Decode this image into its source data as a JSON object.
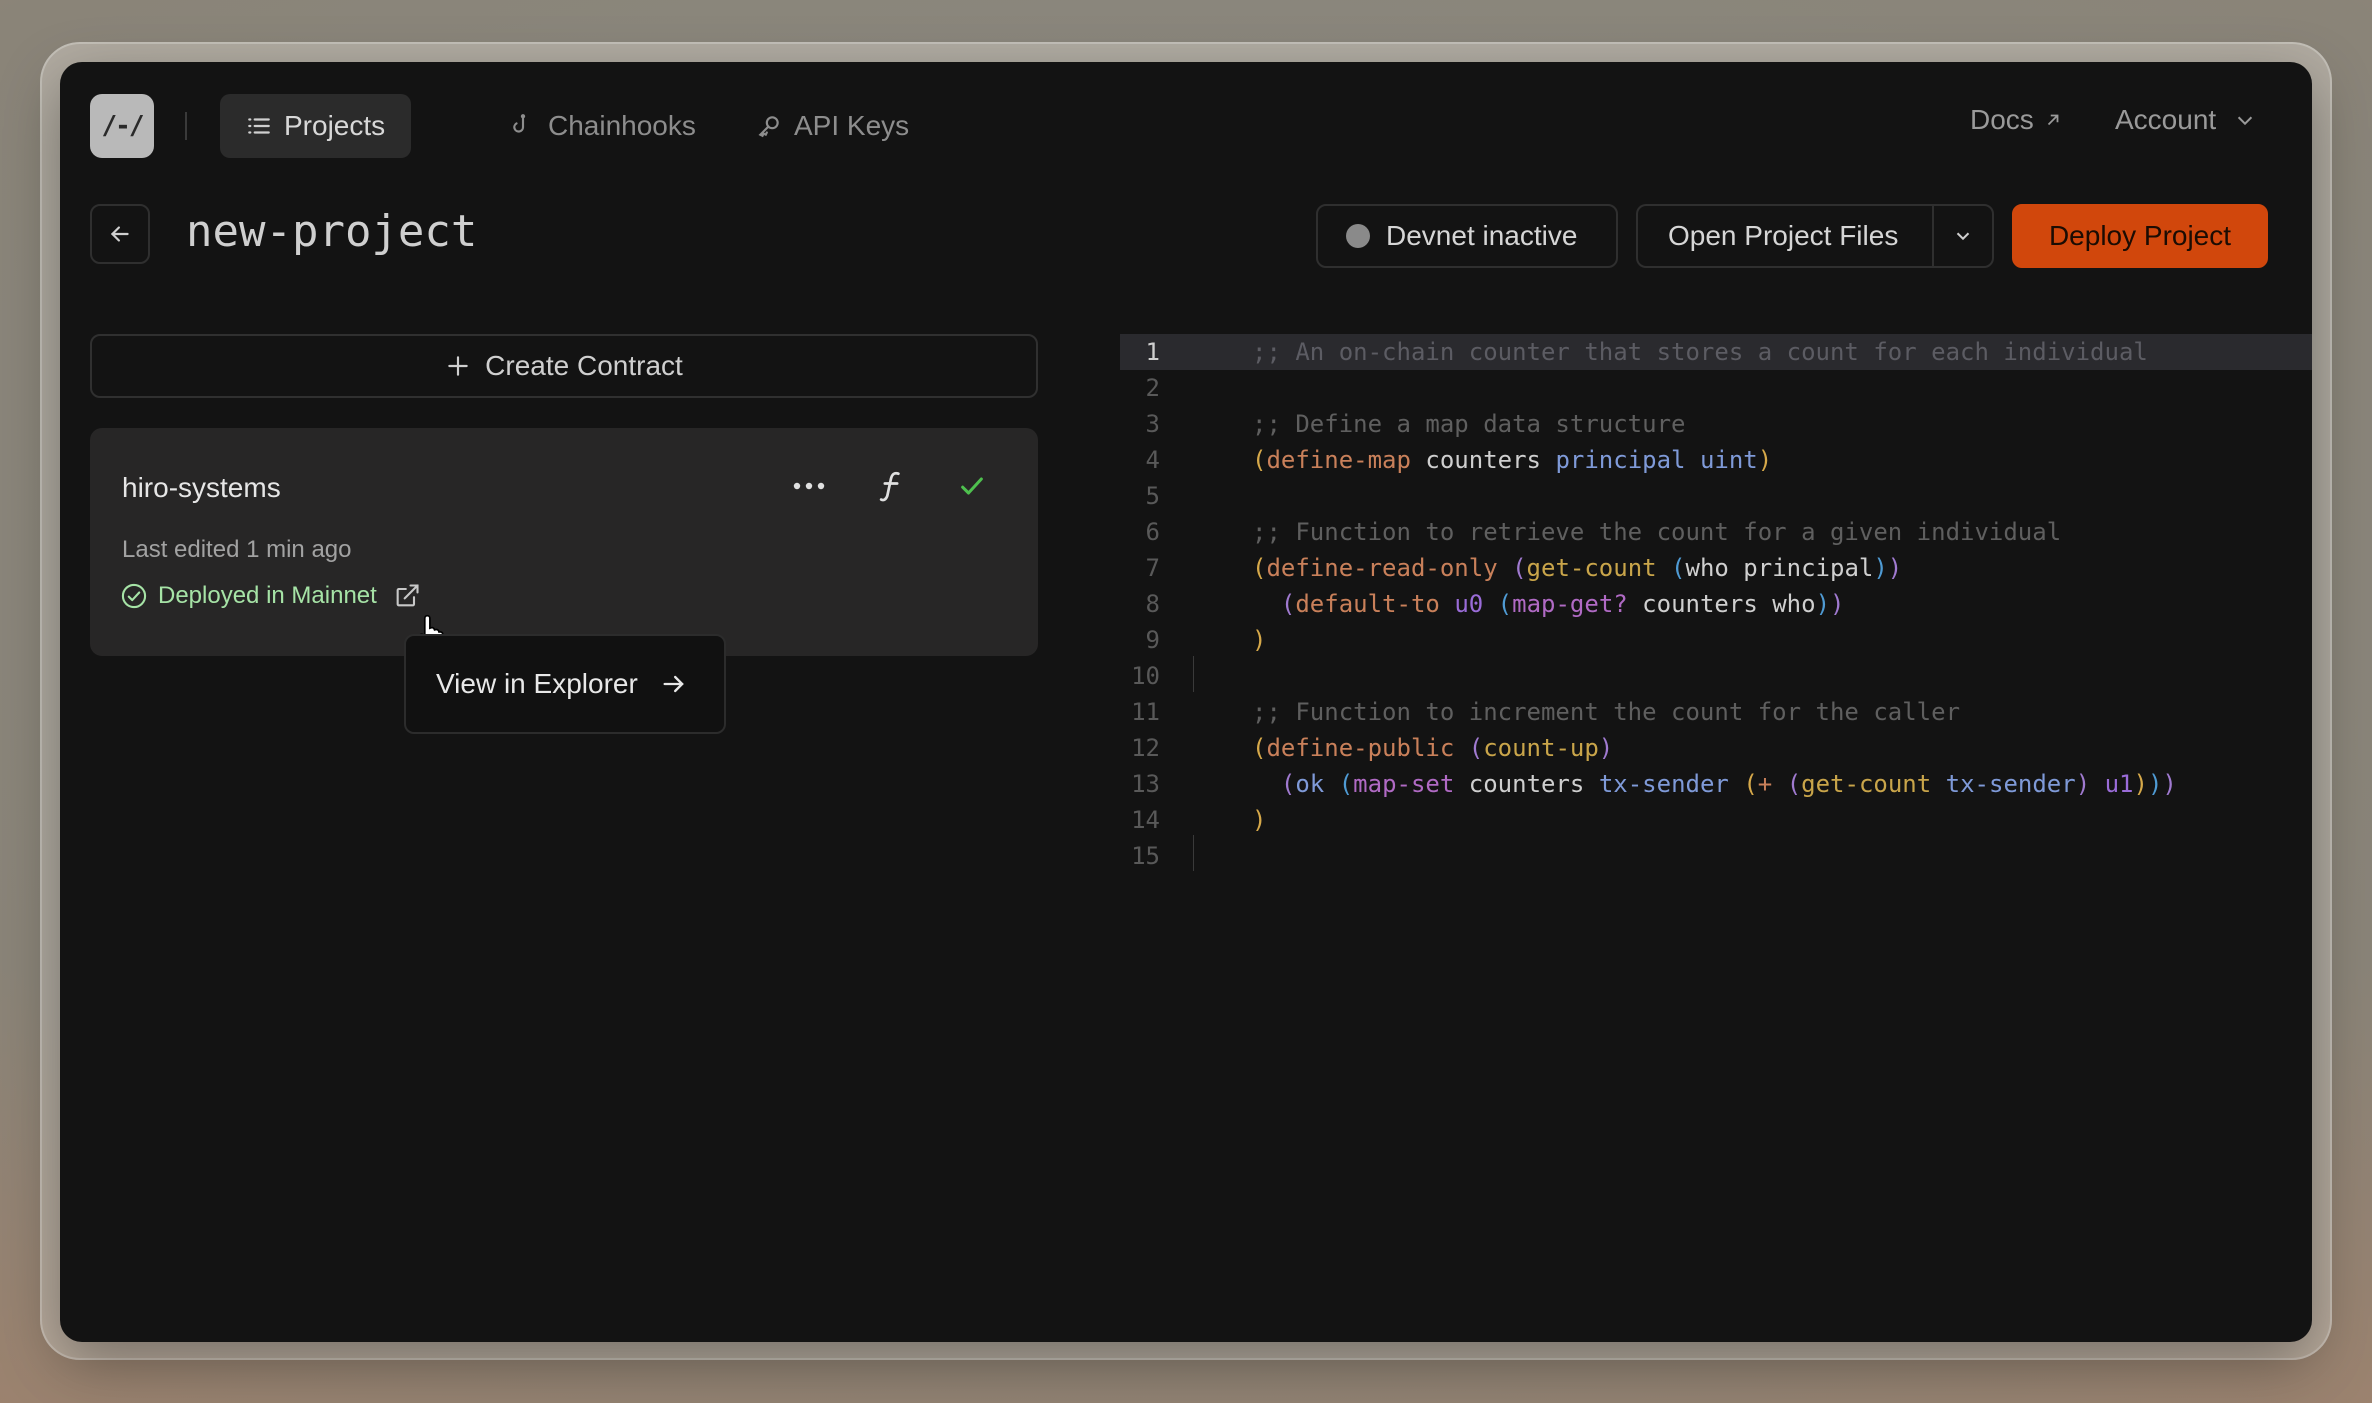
{
  "nav": {
    "logo_text": "/-/",
    "items": [
      {
        "label": "Projects",
        "active": true
      },
      {
        "label": "Chainhooks",
        "active": false
      },
      {
        "label": "API Keys",
        "active": false
      }
    ],
    "docs_label": "Docs",
    "account_label": "Account"
  },
  "project": {
    "title": "new-project",
    "devnet_label": "Devnet inactive",
    "open_files_label": "Open Project Files",
    "deploy_label": "Deploy Project"
  },
  "sidebar": {
    "create_label": "Create Contract",
    "contract": {
      "name": "hiro-systems",
      "last_edited": "Last edited 1 min ago",
      "deploy_status": "Deployed in Mainnet"
    },
    "tooltip_label": "View in Explorer"
  },
  "editor": {
    "current_line": 1,
    "lines": [
      ";; An on-chain counter that stores a count for each individual",
      "",
      ";; Define a map data structure",
      "(define-map counters principal uint)",
      "",
      ";; Function to retrieve the count for a given individual",
      "(define-read-only (get-count (who principal))",
      "  (default-to u0 (map-get? counters who))",
      ")",
      "",
      ";; Function to increment the count for the caller",
      "(define-public (count-up)",
      "  (ok (map-set counters tx-sender (+ (get-count tx-sender) u1)))",
      ")",
      ""
    ]
  },
  "colors": {
    "accent": "#d1470c",
    "success": "#4ec04e",
    "background": "#131313"
  }
}
